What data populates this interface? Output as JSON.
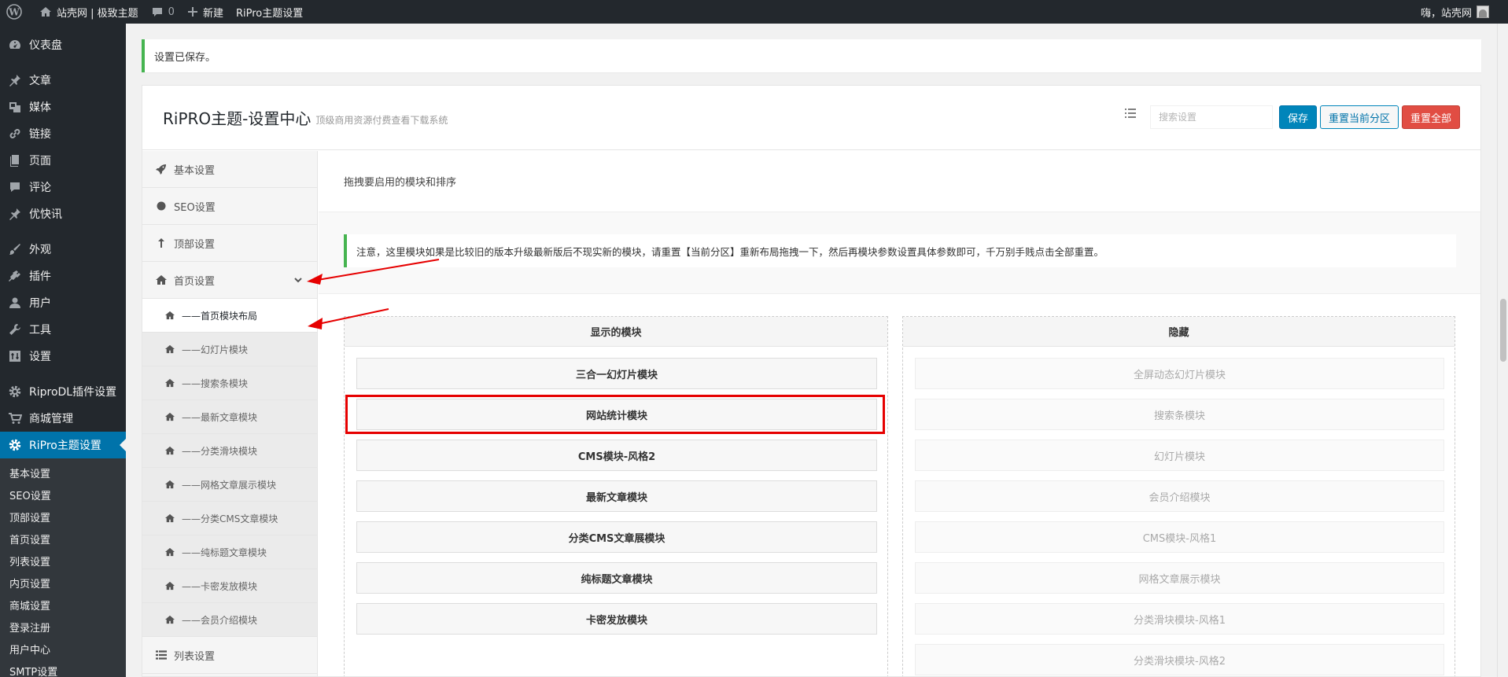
{
  "adminbar": {
    "site_name": "站壳网 | 极致主题",
    "comments_count": "0",
    "new_label": "新建",
    "theme_link": "RiPro主题设置",
    "greeting": "嗨，站壳网"
  },
  "menu": {
    "items": [
      {
        "label": "仪表盘",
        "icon": "dashboard-icon"
      },
      {
        "label": "文章",
        "icon": "pin-icon"
      },
      {
        "label": "媒体",
        "icon": "media-icon"
      },
      {
        "label": "链接",
        "icon": "link-icon"
      },
      {
        "label": "页面",
        "icon": "page-icon"
      },
      {
        "label": "评论",
        "icon": "comment-icon"
      },
      {
        "label": "优快讯",
        "icon": "pin-icon"
      },
      {
        "label": "外观",
        "icon": "brush-icon"
      },
      {
        "label": "插件",
        "icon": "plugin-icon"
      },
      {
        "label": "用户",
        "icon": "user-icon"
      },
      {
        "label": "工具",
        "icon": "wrench-icon"
      },
      {
        "label": "设置",
        "icon": "settings-icon"
      },
      {
        "label": "RiproDL插件设置",
        "icon": "gear-icon"
      },
      {
        "label": "商城管理",
        "icon": "cart-icon"
      },
      {
        "label": "RiPro主题设置",
        "icon": "gear-icon"
      }
    ],
    "submenu": [
      "基本设置",
      "SEO设置",
      "顶部设置",
      "首页设置",
      "列表设置",
      "内页设置",
      "商城设置",
      "登录注册",
      "用户中心",
      "SMTP设置"
    ]
  },
  "notice": "设置已保存。",
  "panel": {
    "title": "RiPRO主题-设置中心",
    "subtitle": "顶级商用资源付费查看下载系统",
    "search_placeholder": "搜索设置",
    "save_label": "保存",
    "reset_section_label": "重置当前分区",
    "reset_all_label": "重置全部"
  },
  "nav": {
    "basic": "基本设置",
    "seo": "SEO设置",
    "top": "顶部设置",
    "home": "首页设置",
    "home_subs": [
      "——首页模块布局",
      "——幻灯片模块",
      "——搜索条模块",
      "——最新文章模块",
      "——分类滑块模块",
      "——网格文章展示模块",
      "——分类CMS文章模块",
      "——纯标题文章模块",
      "——卡密发放模块",
      "——会员介绍模块"
    ],
    "list": "列表设置"
  },
  "content": {
    "description": "拖拽要启用的模块和排序",
    "notice": "注意，这里模块如果是比较旧的版本升级最新版后不现实新的模块，请重置【当前分区】重新布局拖拽一下，然后再模块参数设置具体参数即可，千万别手贱点击全部重置。",
    "enabled_title": "显示的模块",
    "disabled_title": "隐藏",
    "enabled_modules": [
      "三合一幻灯片模块",
      "网站统计模块",
      "CMS模块-风格2",
      "最新文章模块",
      "分类CMS文章展模块",
      "纯标题文章模块",
      "卡密发放模块"
    ],
    "disabled_modules": [
      "全屏动态幻灯片模块",
      "搜索条模块",
      "幻灯片模块",
      "会员介绍模块",
      "CMS模块-风格1",
      "网格文章展示模块",
      "分类滑块模块-风格1",
      "分类滑块模块-风格2"
    ]
  },
  "colors": {
    "adminbar": "#23282d",
    "menu_current": "#0073aa",
    "save_button": "#0085ba",
    "reset_all_button": "#e14d43",
    "notice_border": "#46b450",
    "annotation": "#e60000"
  }
}
